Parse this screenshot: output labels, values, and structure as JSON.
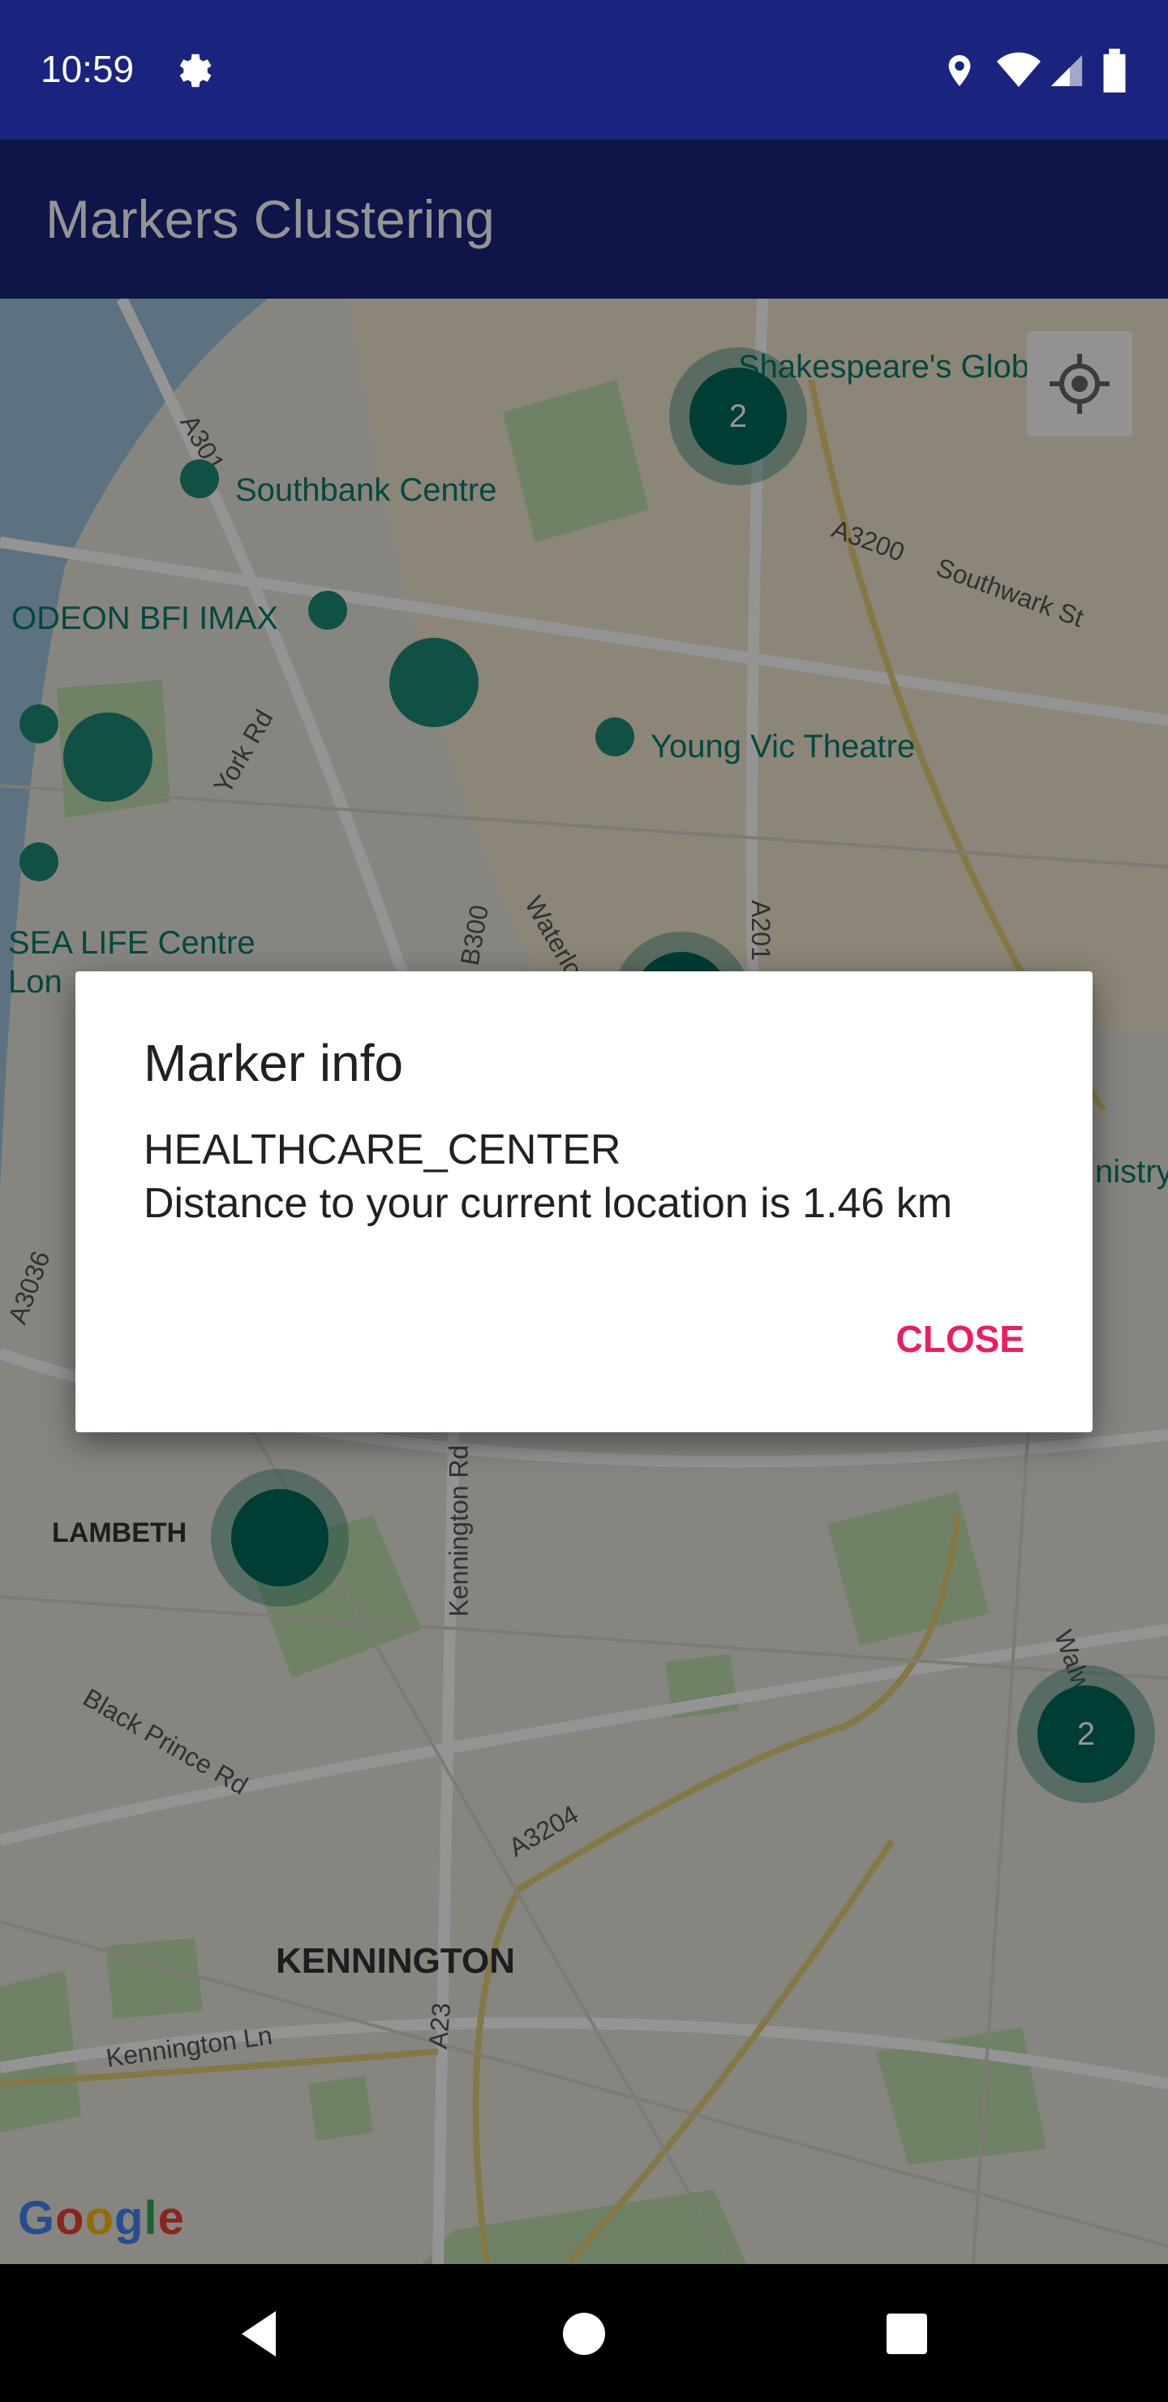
{
  "status_bar": {
    "time": "10:59"
  },
  "app_bar": {
    "title": "Markers Clustering"
  },
  "map": {
    "places": {
      "southbank": "Southbank Centre",
      "odeon": "ODEON BFI IMAX",
      "young_vic": "Young Vic Theatre",
      "sea_life_1": "SEA LIFE Centre",
      "sea_life_2": "Lon",
      "shakespeare": "Shakespeare's Glob",
      "ministry": "nistry"
    },
    "roads": {
      "a301": "A301",
      "a3200": "A3200",
      "southwark": "Southwark St",
      "york": "York Rd",
      "b300": "B300",
      "waterloo": "Waterlo",
      "a201": "A201",
      "a3036": "A3036",
      "kennington_rd": "Kennington Rd",
      "black_prince": "Black Prince Rd",
      "a3204": "A3204",
      "a23": "A23",
      "kennington_ln": "Kennington Ln",
      "walworth": "Walw"
    },
    "areas": {
      "lambeth": "LAMBETH",
      "kennington": "KENNINGTON"
    },
    "clusters": {
      "top": "2",
      "right": "2"
    },
    "attribution": "Google"
  },
  "dialog": {
    "title": "Marker info",
    "line1": "HEALTHCARE_CENTER",
    "line2": "Distance to your current location is 1.46 km",
    "close": "CLOSE"
  },
  "colors": {
    "primary": "#1a237e",
    "accent": "#e91e63",
    "cluster": "#00695c"
  }
}
